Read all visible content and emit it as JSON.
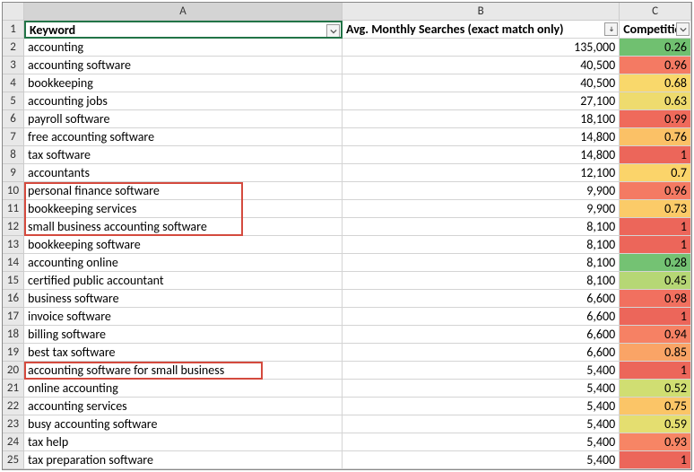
{
  "chart_data": {
    "type": "table",
    "columns": [
      "Keyword",
      "Avg. Monthly Searches (exact match only)",
      "Competition"
    ],
    "rows": [
      [
        "accounting",
        135000,
        0.26
      ],
      [
        "accounting software",
        40500,
        0.96
      ],
      [
        "bookkeeping",
        40500,
        0.68
      ],
      [
        "accounting jobs",
        27100,
        0.63
      ],
      [
        "payroll software",
        18100,
        0.99
      ],
      [
        "free accounting software",
        14800,
        0.76
      ],
      [
        "tax software",
        14800,
        1
      ],
      [
        "accountants",
        12100,
        0.7
      ],
      [
        "personal finance software",
        9900,
        0.96
      ],
      [
        "bookkeeping services",
        9900,
        0.73
      ],
      [
        "small business accounting software",
        8100,
        1
      ],
      [
        "bookkeeping software",
        8100,
        1
      ],
      [
        "accounting online",
        8100,
        0.28
      ],
      [
        "certified public accountant",
        8100,
        0.45
      ],
      [
        "business software",
        6600,
        0.98
      ],
      [
        "invoice software",
        6600,
        1
      ],
      [
        "billing software",
        6600,
        0.94
      ],
      [
        "best tax software",
        6600,
        0.85
      ],
      [
        "accounting software for small business",
        5400,
        1
      ],
      [
        "online accounting",
        5400,
        0.52
      ],
      [
        "accounting services",
        5400,
        0.75
      ],
      [
        "busy accounting software",
        5400,
        0.59
      ],
      [
        "tax help",
        5400,
        0.93
      ],
      [
        "tax preparation software",
        5400,
        1
      ]
    ]
  },
  "columns": {
    "A": "A",
    "B": "B",
    "C": "C"
  },
  "headers": {
    "keyword": "Keyword",
    "searches": "Avg. Monthly Searches (exact match only)",
    "competition": "Competition"
  },
  "rows": [
    {
      "n": 2,
      "kw": "accounting",
      "s": "135,000",
      "c": "0.26",
      "color": "#70c070"
    },
    {
      "n": 3,
      "kw": "accounting software",
      "s": "40,500",
      "c": "0.96",
      "color": "#f47a63"
    },
    {
      "n": 4,
      "kw": "bookkeeping",
      "s": "40,500",
      "c": "0.68",
      "color": "#f9d86b"
    },
    {
      "n": 5,
      "kw": "accounting jobs",
      "s": "27,100",
      "c": "0.63",
      "color": "#eedb6e"
    },
    {
      "n": 6,
      "kw": "payroll software",
      "s": "18,100",
      "c": "0.99",
      "color": "#ef6a5b"
    },
    {
      "n": 7,
      "kw": "free accounting software",
      "s": "14,800",
      "c": "0.76",
      "color": "#fbc166"
    },
    {
      "n": 8,
      "kw": "tax software",
      "s": "14,800",
      "c": "1",
      "color": "#ec665a"
    },
    {
      "n": 9,
      "kw": "accountants",
      "s": "12,100",
      "c": "0.7",
      "color": "#fbd46a"
    },
    {
      "n": 10,
      "kw": "personal finance software",
      "s": "9,900",
      "c": "0.96",
      "color": "#f47a63"
    },
    {
      "n": 11,
      "kw": "bookkeeping services",
      "s": "9,900",
      "c": "0.73",
      "color": "#fbcb68"
    },
    {
      "n": 12,
      "kw": "small business accounting software",
      "s": "8,100",
      "c": "1",
      "color": "#ec665a"
    },
    {
      "n": 13,
      "kw": "bookkeeping software",
      "s": "8,100",
      "c": "1",
      "color": "#ec665a"
    },
    {
      "n": 14,
      "kw": "accounting online",
      "s": "8,100",
      "c": "0.28",
      "color": "#74c273"
    },
    {
      "n": 15,
      "kw": "certified public accountant",
      "s": "8,100",
      "c": "0.45",
      "color": "#b6d775"
    },
    {
      "n": 16,
      "kw": "business software",
      "s": "6,600",
      "c": "0.98",
      "color": "#f1705f"
    },
    {
      "n": 17,
      "kw": "invoice software",
      "s": "6,600",
      "c": "1",
      "color": "#ec665a"
    },
    {
      "n": 18,
      "kw": "billing software",
      "s": "6,600",
      "c": "0.94",
      "color": "#f68164"
    },
    {
      "n": 19,
      "kw": "best tax software",
      "s": "6,600",
      "c": "0.85",
      "color": "#faa466"
    },
    {
      "n": 20,
      "kw": "accounting software for small business",
      "s": "5,400",
      "c": "1",
      "color": "#ec665a"
    },
    {
      "n": 21,
      "kw": "online accounting",
      "s": "5,400",
      "c": "0.52",
      "color": "#d0de72"
    },
    {
      "n": 22,
      "kw": "accounting services",
      "s": "5,400",
      "c": "0.75",
      "color": "#fbc567"
    },
    {
      "n": 23,
      "kw": "busy accounting software",
      "s": "5,400",
      "c": "0.59",
      "color": "#e4de70"
    },
    {
      "n": 24,
      "kw": "tax help",
      "s": "5,400",
      "c": "0.93",
      "color": "#f78565"
    },
    {
      "n": 25,
      "kw": "tax preparation software",
      "s": "5,400",
      "c": "1",
      "color": "#ec665a"
    }
  ]
}
